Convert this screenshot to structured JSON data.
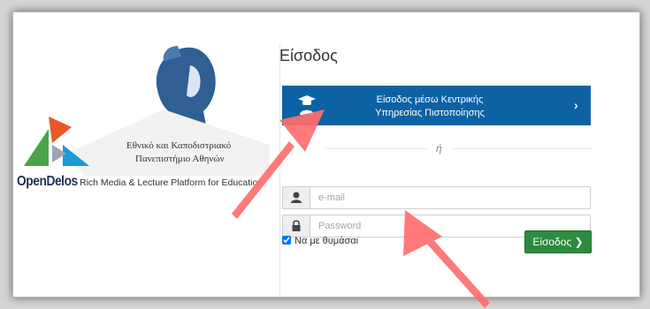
{
  "branding": {
    "university_line1": "Εθνικό και Καποδιστριακό",
    "university_line2": "Πανεπιστήμιο Αθηνών",
    "platform_name": "OpenDelos",
    "platform_tagline": "Rich Media & Lecture Platform for Education",
    "colors": {
      "orange": "#e8582a",
      "green": "#4aa34a",
      "blue": "#1a9ad6",
      "navy": "#1e3150",
      "helmet": "#2f5f93"
    }
  },
  "login": {
    "title": "Είσοδος",
    "sso_line1": "Είσοδος μέσω Κεντρικής",
    "sso_line2": "Υπηρεσίας Πιστοποίησης",
    "sso_icon": "graduation-cap-user-icon",
    "or_text": "ή",
    "email_placeholder": "e-mail",
    "email_icon": "user-icon",
    "password_placeholder": "Password",
    "password_icon": "lock-icon",
    "remember_label": "Να με θυμάσαι",
    "remember_checked": true,
    "submit_label": "Είσοδος",
    "accent_blue": "#0d62a4",
    "accent_green": "#2d8a3e"
  },
  "annotations": {
    "arrow_color": "#ff6b6b"
  }
}
